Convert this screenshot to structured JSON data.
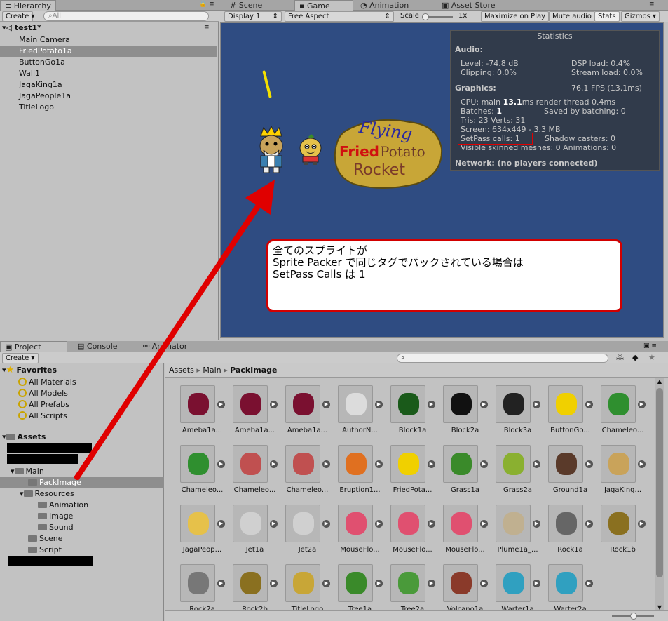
{
  "hierarchy": {
    "tab": "Hierarchy",
    "create": "Create",
    "search_placeholder": "All",
    "scene": "test1*",
    "items": [
      "Main Camera",
      "FriedPotato1a",
      "ButtonGo1a",
      "Wall1",
      "JagaKing1a",
      "JagaPeople1a",
      "TitleLogo"
    ],
    "selected": "FriedPotato1a"
  },
  "viewtabs": {
    "scene": "Scene",
    "game": "Game",
    "animation": "Animation",
    "asset_store": "Asset Store"
  },
  "game_toolbar": {
    "display": "Display 1",
    "aspect": "Free Aspect",
    "scale_label": "Scale",
    "scale_value": "1x",
    "maximize": "Maximize on Play",
    "mute": "Mute audio",
    "stats": "Stats",
    "gizmos": "Gizmos"
  },
  "stats": {
    "title": "Statistics",
    "audio": "Audio:",
    "level": "Level: -74.8 dB",
    "clipping": "Clipping: 0.0%",
    "dsp": "DSP load: 0.4%",
    "stream": "Stream load: 0.0%",
    "graphics": "Graphics:",
    "fps": "76.1 FPS (13.1ms)",
    "cpu_prefix": "CPU: main ",
    "cpu_value": "13.1",
    "cpu_suffix": "ms  render thread 0.4ms",
    "batches_prefix": "Batches: ",
    "batches_value": "1",
    "saved": "Saved by batching: 0",
    "tris": "Tris: 23   Verts: 31",
    "screen": "Screen: 634x449 - 3.3 MB",
    "setpass": "SetPass calls: 1",
    "shadow": "Shadow casters: 0",
    "skinned": "Visible skinned meshes: 0  Animations: 0",
    "network": "Network: (no players connected)"
  },
  "game_logo": {
    "line1": "Flying",
    "line2a": "Fried",
    "line2b": "Potato",
    "line3": "Rocket"
  },
  "callout": {
    "line1": "全てのスプライトが",
    "line2": "Sprite Packer で同じタグでパックされている場合は",
    "line3": "SetPass Calls は 1"
  },
  "project": {
    "tab": "Project",
    "console": "Console",
    "animator": "Animator",
    "create": "Create",
    "favorites": "Favorites",
    "fav_items": [
      "All Materials",
      "All Models",
      "All Prefabs",
      "All Scripts"
    ],
    "assets": "Assets",
    "main": "Main",
    "packimage": "PackImage",
    "resources": "Resources",
    "res_items": [
      "Animation",
      "Image",
      "Sound"
    ],
    "scene": "Scene",
    "script": "Script",
    "breadcrumb": [
      "Assets",
      "Main",
      "PackImage"
    ],
    "assets_grid": [
      "Ameba1a...",
      "Ameba1a...",
      "Ameba1a...",
      "AuthorN...",
      "Block1a",
      "Block2a",
      "Block3a",
      "ButtonGo...",
      "Chameleo...",
      "Chameleo...",
      "Chameleo...",
      "Chameleo...",
      "Eruption1...",
      "FriedPota...",
      "Grass1a",
      "Grass2a",
      "Ground1a",
      "JagaKing...",
      "JagaPeop...",
      "Jet1a",
      "Jet2a",
      "MouseFlo...",
      "MouseFlo...",
      "MouseFlo...",
      "Plume1a_...",
      "Rock1a",
      "Rock1b",
      "Rock2a",
      "Rock2b",
      "TitleLogo",
      "Tree1a",
      "Tree2a",
      "Volcano1a",
      "Warter1a",
      "Warter2a"
    ]
  },
  "colors": {
    "game_bg": "#2f4c82",
    "accent_red": "#e00000",
    "selection": "#8e8e8e"
  }
}
